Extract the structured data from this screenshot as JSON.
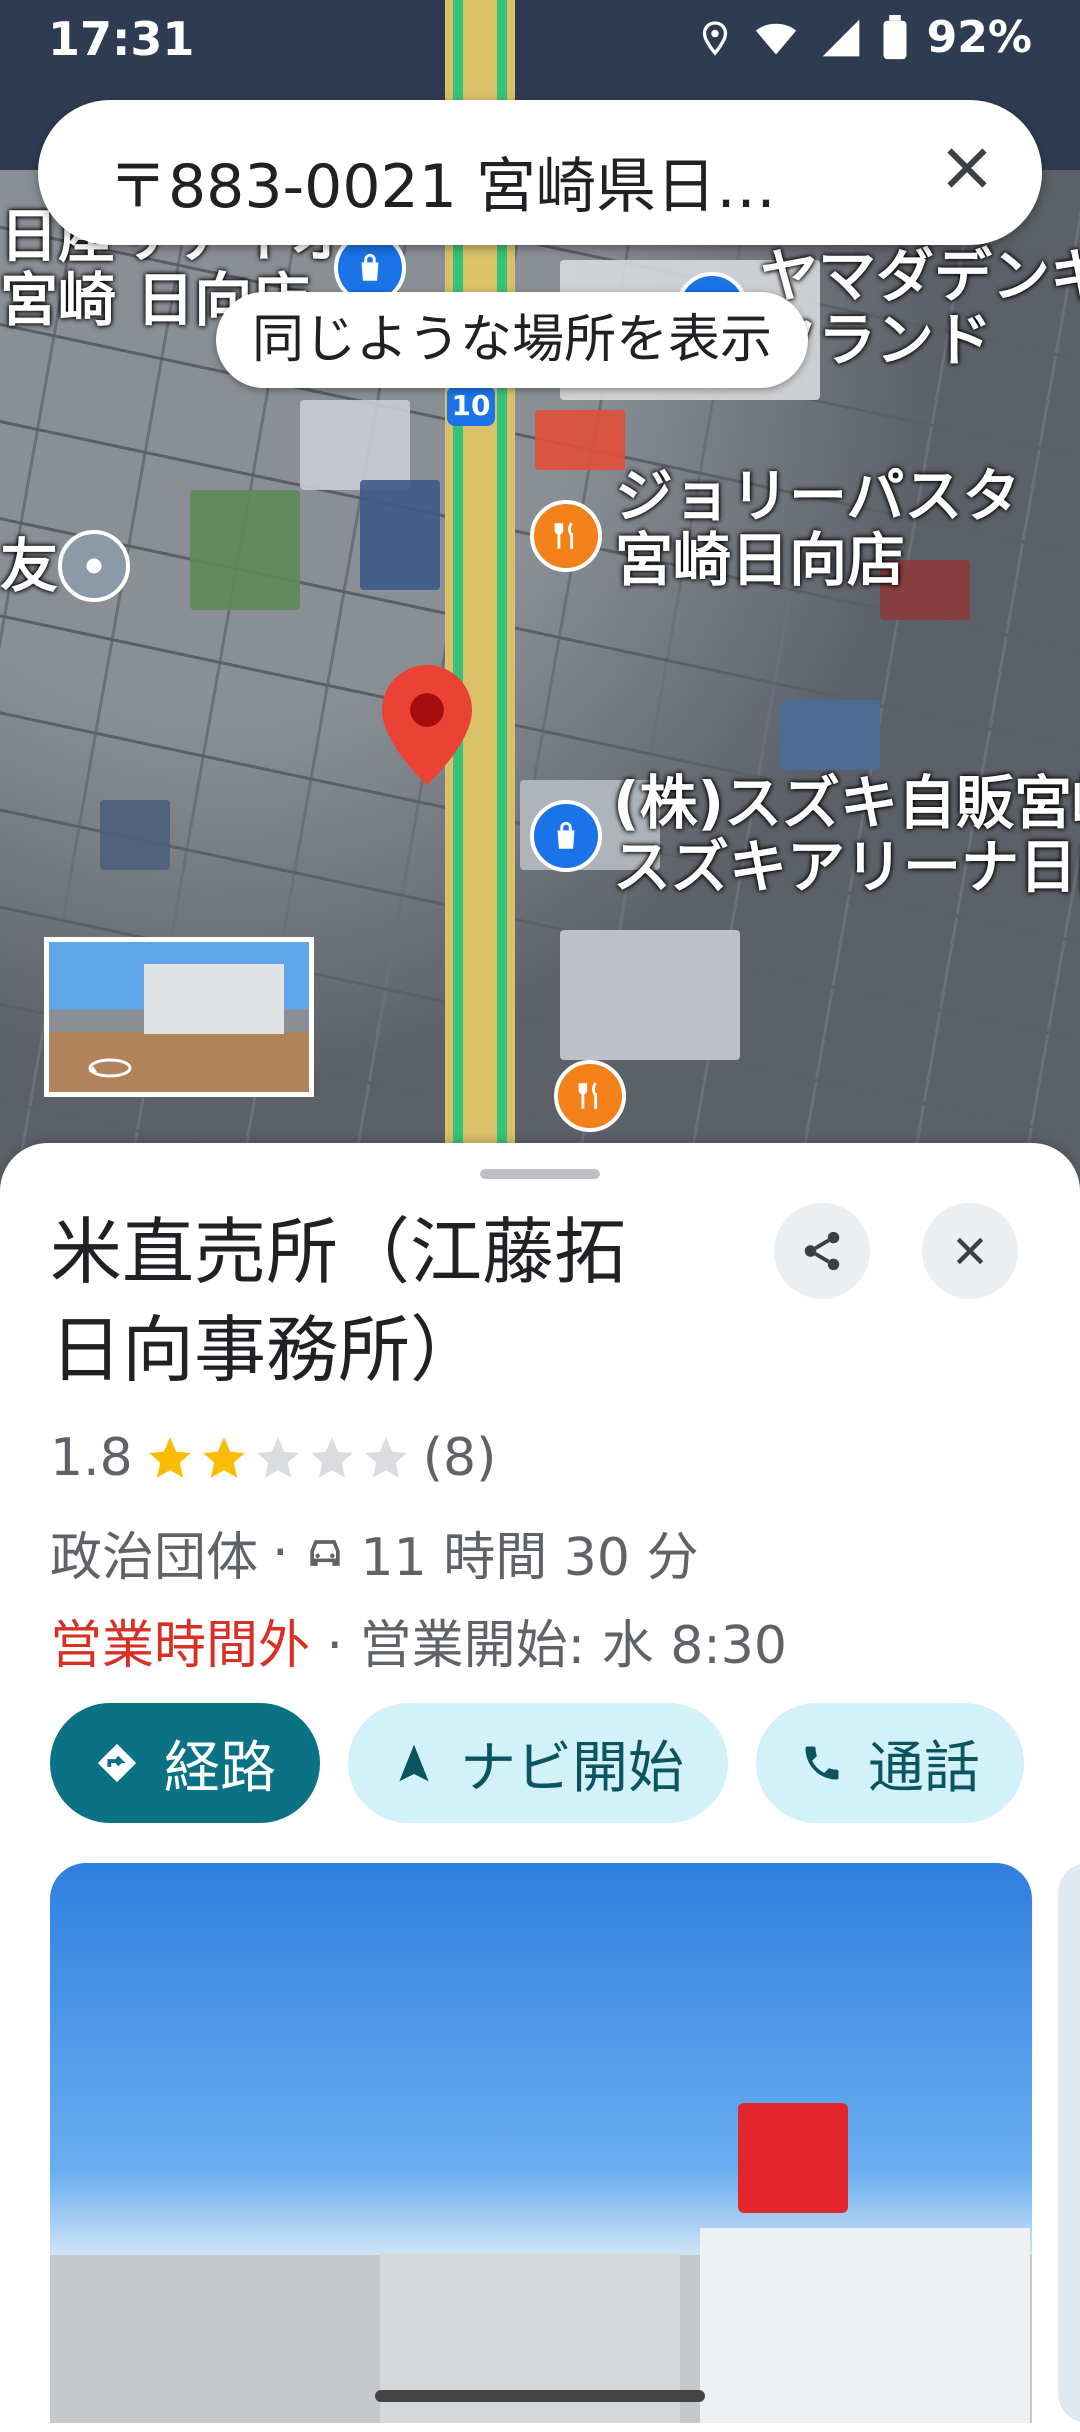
{
  "status": {
    "time": "17:31",
    "battery": "92%"
  },
  "search": {
    "query": "〒883-0021 宮崎県日…"
  },
  "map": {
    "similar_chip": "同じような場所を表示",
    "labels": {
      "nissan": "日産サテイオ\n宮崎 日向店",
      "yamada": "ヤマダデンキ\nクランド",
      "jolly": "ジョリーパスタ\n宮崎日向店",
      "suzuki": "(株)スズキ自販宮崎\nスズキアリーナ日向",
      "tomo": "友"
    },
    "route_number": "10"
  },
  "place": {
    "name": "米直売所（江藤拓\n日向事務所）",
    "rating": "1.8",
    "stars_filled": 2,
    "review_count": "(8)",
    "category": "政治団体",
    "drive_time": "11 時間 30 分",
    "status_closed": "営業時間外",
    "opens": "営業開始: 水 8:30",
    "actions": {
      "directions": "経路",
      "start_nav": "ナビ開始",
      "call": "通話"
    }
  },
  "colors": {
    "accent": "#0b7285",
    "closed": "#d93025",
    "star": "#fbbc04"
  }
}
